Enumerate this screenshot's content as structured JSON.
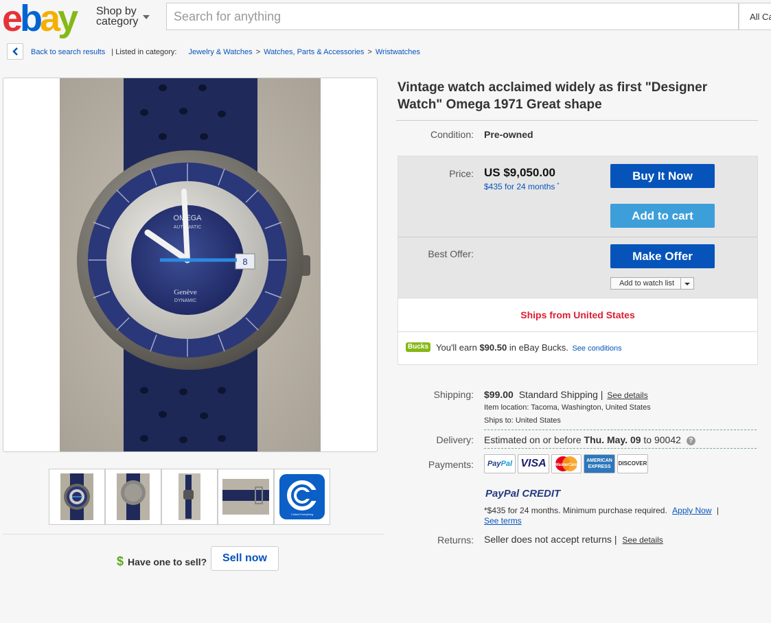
{
  "header": {
    "logo_letters": [
      "e",
      "b",
      "a",
      "y"
    ],
    "logo_colors": [
      "#e53238",
      "#0064d2",
      "#f5af02",
      "#86b817"
    ],
    "shop_by_line1": "Shop by",
    "shop_by_line2": "category",
    "search_placeholder": "Search for anything",
    "all_categories": "All Ca"
  },
  "breadcrumb": {
    "back": "Back to search results",
    "listed": "| Listed in category:",
    "items": [
      "Jewelry & Watches",
      "Watches, Parts & Accessories",
      "Wristwatches"
    ],
    "separator": ">"
  },
  "item": {
    "title": "Vintage watch acclaimed widely as first \"Designer Watch\"  Omega 1971 Great shape",
    "condition_label": "Condition:",
    "condition": "Pre-owned",
    "price_label": "Price:",
    "price": "US $9,050.00",
    "financing": "$435 for 24 months",
    "financing_mark": "*",
    "buy_now": "Buy It Now",
    "add_to_cart": "Add to cart",
    "best_offer_label": "Best Offer:",
    "make_offer": "Make Offer",
    "add_to_watch": "Add to watch list",
    "ships_from": "Ships from United States",
    "bucks_badge": "Bucks",
    "bucks_pre": "You'll earn",
    "bucks_amount": "$90.50",
    "bucks_post": "in eBay Bucks.",
    "bucks_conditions": "See conditions"
  },
  "shipping": {
    "label": "Shipping:",
    "cost": "$99.00",
    "method": "Standard Shipping |",
    "details": "See details",
    "location": "Item location:  Tacoma, Washington, United States",
    "ships_to": "Ships to:  United States"
  },
  "delivery": {
    "label": "Delivery:",
    "pre": "Estimated on or before",
    "date": "Thu. May. 09",
    "post": "to 90042",
    "help": "?"
  },
  "payments": {
    "label": "Payments:",
    "paypal_a": "Pay",
    "paypal_b": "Pal",
    "visa": "VISA",
    "mastercard": "MasterCard",
    "amex_1": "AMERICAN",
    "amex_2": "EXPRESS",
    "discover": "DISCOVER",
    "paypal_credit_a": "PayPal",
    "paypal_credit_b": " CREDIT",
    "credit_terms": "*$435 for 24 months. Minimum purchase required.",
    "apply_now": "Apply Now",
    "pipe": "|",
    "see_terms": "See terms"
  },
  "returns": {
    "label": "Returns:",
    "text": "Seller does not accept returns |",
    "details": "See details"
  },
  "sell": {
    "dollar": "$",
    "text": "Have one to sell?",
    "button": "Sell now"
  },
  "gallery": {
    "brand_on_dial_1": "OMEGA",
    "brand_on_dial_2": "AUTOMATIC",
    "dial_text_1": "Genève",
    "dial_text_2": "DYNAMIC",
    "date_window": "8",
    "app_tile_caption": "Collect Everything"
  },
  "colors": {
    "primary_blue": "#0654ba",
    "light_blue": "#3d9fd9",
    "ships_red": "#dd1e31",
    "bucks_green": "#5ba71b"
  }
}
